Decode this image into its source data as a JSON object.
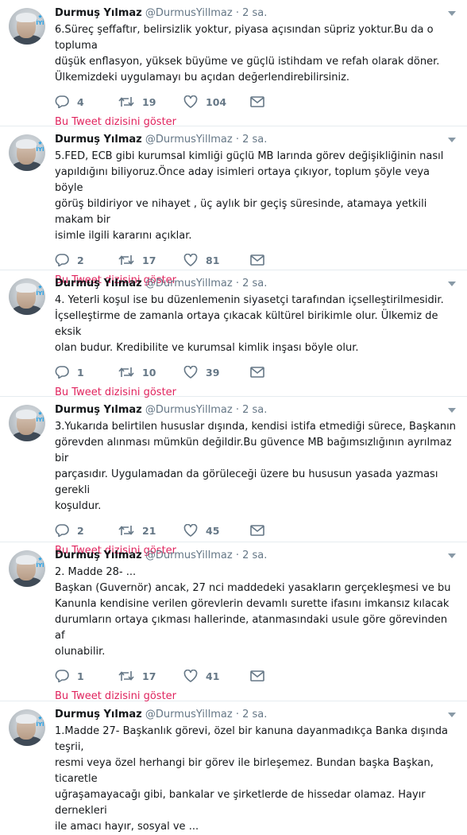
{
  "tweets": [
    {
      "name": "Durmuş Yılmaz",
      "handle": "@DurmusYillmaz",
      "sep": "·",
      "time": "2 sa.",
      "text": "6.Süreç şeffaftır, belirsizlik yoktur, piyasa açısından süpriz yoktur.Bu da o topluma\ndüşük enflasyon, yüksek büyüme ve güçlü istihdam ve refah olarak döner.\nÜlkemizdeki uygulamayı bu açıdan değerlendirebilirsiniz.",
      "replies": "4",
      "retweets": "19",
      "likes": "104",
      "thread": "Bu Tweet dizisini göster"
    },
    {
      "name": "Durmuş Yılmaz",
      "handle": "@DurmusYillmaz",
      "sep": "·",
      "time": "2 sa.",
      "text": "5.FED, ECB gibi kurumsal kimliği güçlü MB larında görev değişikliğinin nasıl\nyapıldığını biliyoruz.Önce aday isimleri ortaya çıkıyor, toplum şöyle veya böyle\ngörüş bildiriyor ve nihayet , üç aylık bir geçiş süresinde, atamaya yetkili makam bir\nisimle ilgili kararını açıklar.",
      "replies": "2",
      "retweets": "17",
      "likes": "81",
      "thread": "Bu Tweet dizisini göster"
    },
    {
      "name": "Durmuş Yılmaz",
      "handle": "@DurmusYillmaz",
      "sep": "·",
      "time": "2 sa.",
      "text": "4. Yeterli koşul ise bu düzenlemenin siyasetçi tarafından içselleştirilmesidir.\nİçselleştirme de zamanla ortaya çıkacak kültürel birikimle olur. Ülkemiz de eksik\nolan budur. Kredibilite ve kurumsal kimlik inşası böyle olur.",
      "replies": "1",
      "retweets": "10",
      "likes": "39",
      "thread": "Bu Tweet dizisini göster"
    },
    {
      "name": "Durmuş Yılmaz",
      "handle": "@DurmusYillmaz",
      "sep": "·",
      "time": "2 sa.",
      "text": "3.Yukarıda belirtilen hususlar dışında, kendisi istifa etmediği sürece, Başkanın\ngörevden alınması mümkün değildir.Bu güvence MB bağımsızlığının ayrılmaz bir\nparçasıdır. Uygulamadan da görüleceği üzere bu hususun yasada yazması gerekli\nkoşuldur.",
      "replies": "2",
      "retweets": "21",
      "likes": "45",
      "thread": "Bu Tweet dizisini göster"
    },
    {
      "name": "Durmuş Yılmaz",
      "handle": "@DurmusYillmaz",
      "sep": "·",
      "time": "2 sa.",
      "text": "2. Madde 28- ...\nBaşkan (Guvernör) ancak, 27 nci maddedeki yasakların gerçekleşmesi ve bu\nKanunla kendisine verilen görevlerin devamlı surette ifasını imkansız kılacak\ndurumların ortaya çıkması hallerinde, atanmasındaki usule göre görevinden af\nolunabilir.",
      "replies": "1",
      "retweets": "17",
      "likes": "41",
      "thread": "Bu Tweet dizisini göster"
    },
    {
      "name": "Durmuş Yılmaz",
      "handle": "@DurmusYillmaz",
      "sep": "·",
      "time": "2 sa.",
      "text": "1.Madde 27- Başkanlık  görevi, özel bir kanuna dayanmadıkça Banka dışında teşrii,\nresmi veya özel herhangi bir görev ile birleşemez. Bundan başka Başkan, ticaretle\nuğraşamayacağı gibi, bankalar ve şirketlerde de hissedar olamaz. Hayır dernekleri\nile amacı hayır, sosyal ve ...",
      "replies": null,
      "retweets": null,
      "likes": null,
      "thread": null
    }
  ],
  "icons": {
    "reply": "reply-icon",
    "retweet": "retweet-icon",
    "like": "heart-icon",
    "dm": "mail-icon",
    "caret": "chevron-down-icon",
    "color_muted": "#657786",
    "color_thread": "#e0245e"
  }
}
